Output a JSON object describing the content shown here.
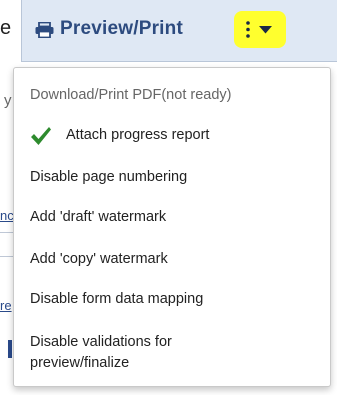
{
  "toolbar": {
    "preview_label": "Preview/Print",
    "printer_icon": "printer-icon",
    "more_icon": "kebab-icon",
    "chevron_icon": "chevron-down-icon",
    "highlight_color": "#ffff2e",
    "accent_color": "#2d4b7f"
  },
  "background": {
    "fragment_e": "e",
    "fragment_y": "y",
    "link_fragment_1": "nc",
    "link_fragment_2": "re"
  },
  "menu": {
    "items": [
      {
        "label": "Download/Print PDF(not ready)",
        "disabled": true
      },
      {
        "label": "Attach progress report",
        "checked": true,
        "icon": "checkmark-icon",
        "check_color": "#2e8b2e"
      },
      {
        "label": "Disable page numbering"
      },
      {
        "label": "Add 'draft' watermark"
      },
      {
        "label": "Add 'copy' watermark"
      },
      {
        "label": "Disable form data mapping"
      },
      {
        "label_line1": "Disable validations for",
        "label_line2": "preview/finalize"
      }
    ]
  }
}
